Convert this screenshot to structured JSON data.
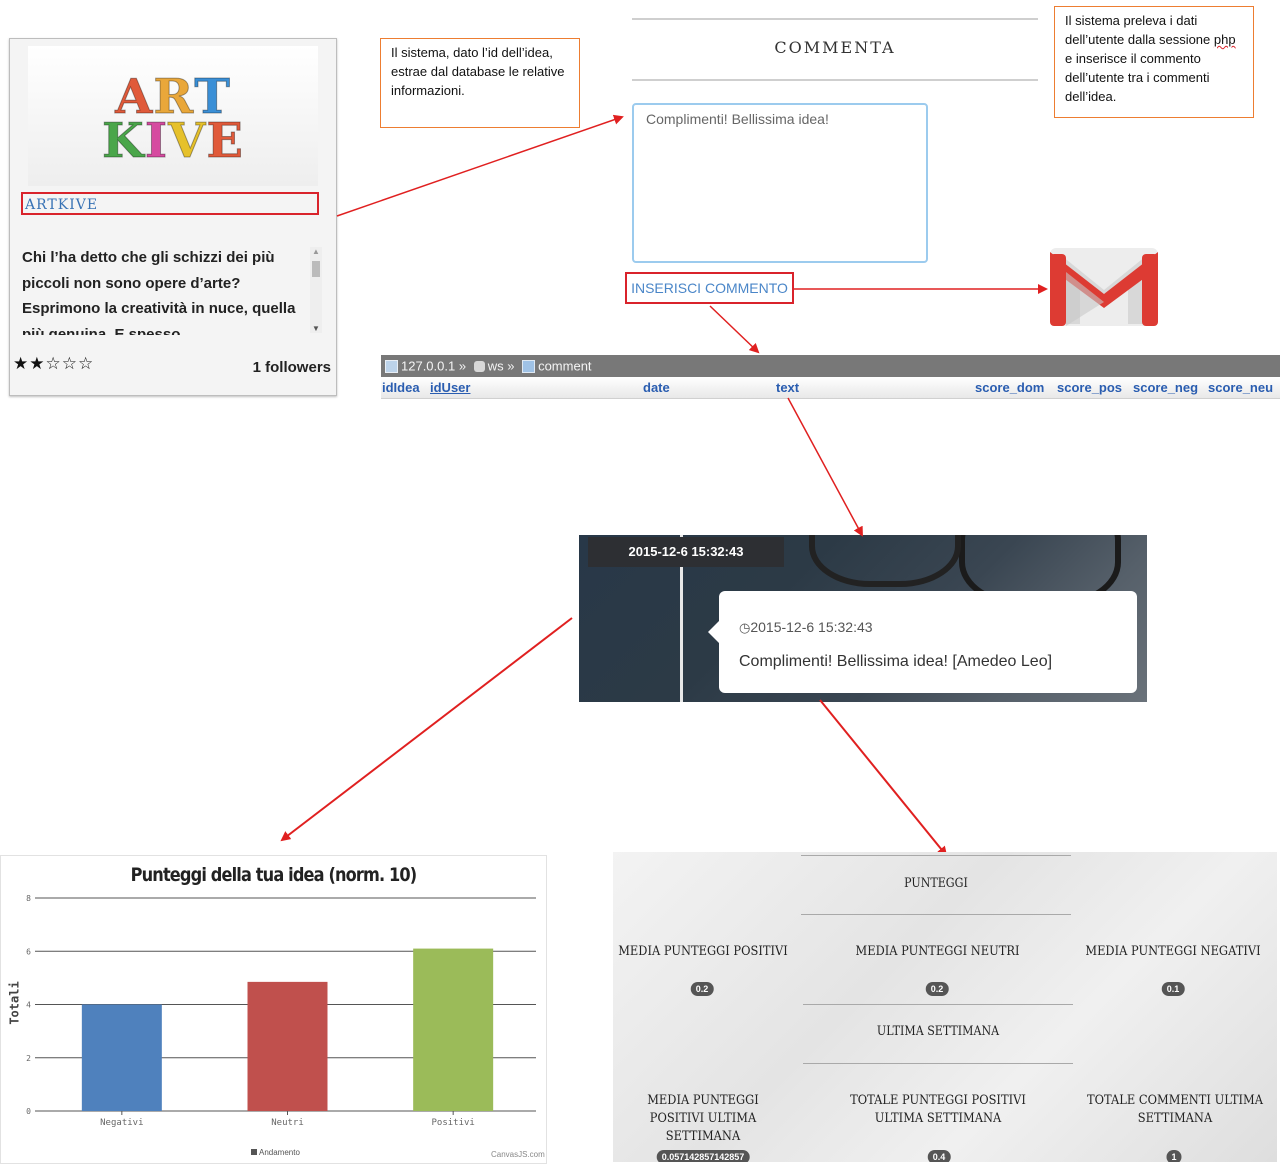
{
  "idea_card": {
    "logo_line1": "ART",
    "logo_line2": "KIVE",
    "title": "ARTKIVE",
    "description": "Chi l’ha detto che gli schizzi dei più piccoli non sono opere d’arte? Esprimono la creatività in nuce, quella più genuina. E spesso",
    "rating_stars": "★★☆☆☆",
    "rating_value": 2,
    "rating_max": 5,
    "followers": "1 followers",
    "logo_colors": [
      "#e05a3a",
      "#e9a73a",
      "#3a8fd6",
      "#4aa64a",
      "#d64aa0",
      "#e6c12b"
    ]
  },
  "notes": {
    "left": "Il sistema, dato l’id dell’idea, estrae dal database le relative informazioni.",
    "right_part1": "Il sistema preleva i dati dell’utente dalla sessione ",
    "right_misspelled": "php",
    "right_part2": " e inserisce il commento dell’utente tra i commenti dell’idea."
  },
  "comment_form": {
    "heading": "COMMENTA",
    "input_value": "Complimenti! Bellissima idea!",
    "submit_label": "INSERISCI COMMENTO"
  },
  "db": {
    "server": "127.0.0.1",
    "database": "ws",
    "table": "comment",
    "separator": "»",
    "columns": [
      "idIdea",
      "idUser",
      "date",
      "text",
      "score_dom",
      "score_pos",
      "score_neg",
      "score_neu"
    ]
  },
  "timeline": {
    "date_badge": "2015-12-6 15:32:43",
    "entry_time": "2015-12-6 15:32:43",
    "entry_text": "Complimenti! Bellissima idea! [Amedeo Leo]"
  },
  "chart_data": {
    "type": "bar",
    "title": "Punteggi della tua idea (norm. 10)",
    "categories": [
      "Negativi",
      "Neutri",
      "Positivi"
    ],
    "values": [
      4,
      4.85,
      6.1
    ],
    "colors": [
      "#4f81bd",
      "#c0504d",
      "#9bbb59"
    ],
    "ylabel": "Totali",
    "xlabel": "",
    "ylim": [
      0,
      8
    ],
    "yticks": [
      0,
      2,
      4,
      6,
      8
    ],
    "legend": "Andamento",
    "credit": "CanvasJS.com",
    "grid": true
  },
  "stats": {
    "heading_scores": "PUNTEGGI",
    "heading_week": "ULTIMA SETTIMANA",
    "items": [
      {
        "label": "MEDIA PUNTEGGI POSITIVI",
        "value": "0.2"
      },
      {
        "label": "MEDIA PUNTEGGI NEUTRI",
        "value": "0.2"
      },
      {
        "label": "MEDIA PUNTEGGI NEGATIVI",
        "value": "0.1"
      },
      {
        "label": "MEDIA PUNTEGGI POSITIVI ULTIMA SETTIMANA",
        "value": "0.057142857142857"
      },
      {
        "label": "TOTALE PUNTEGGI POSITIVI ULTIMA SETTIMANA",
        "value": "0.4"
      },
      {
        "label": "TOTALE COMMENTI ULTIMA SETTIMANA",
        "value": "1"
      }
    ]
  }
}
